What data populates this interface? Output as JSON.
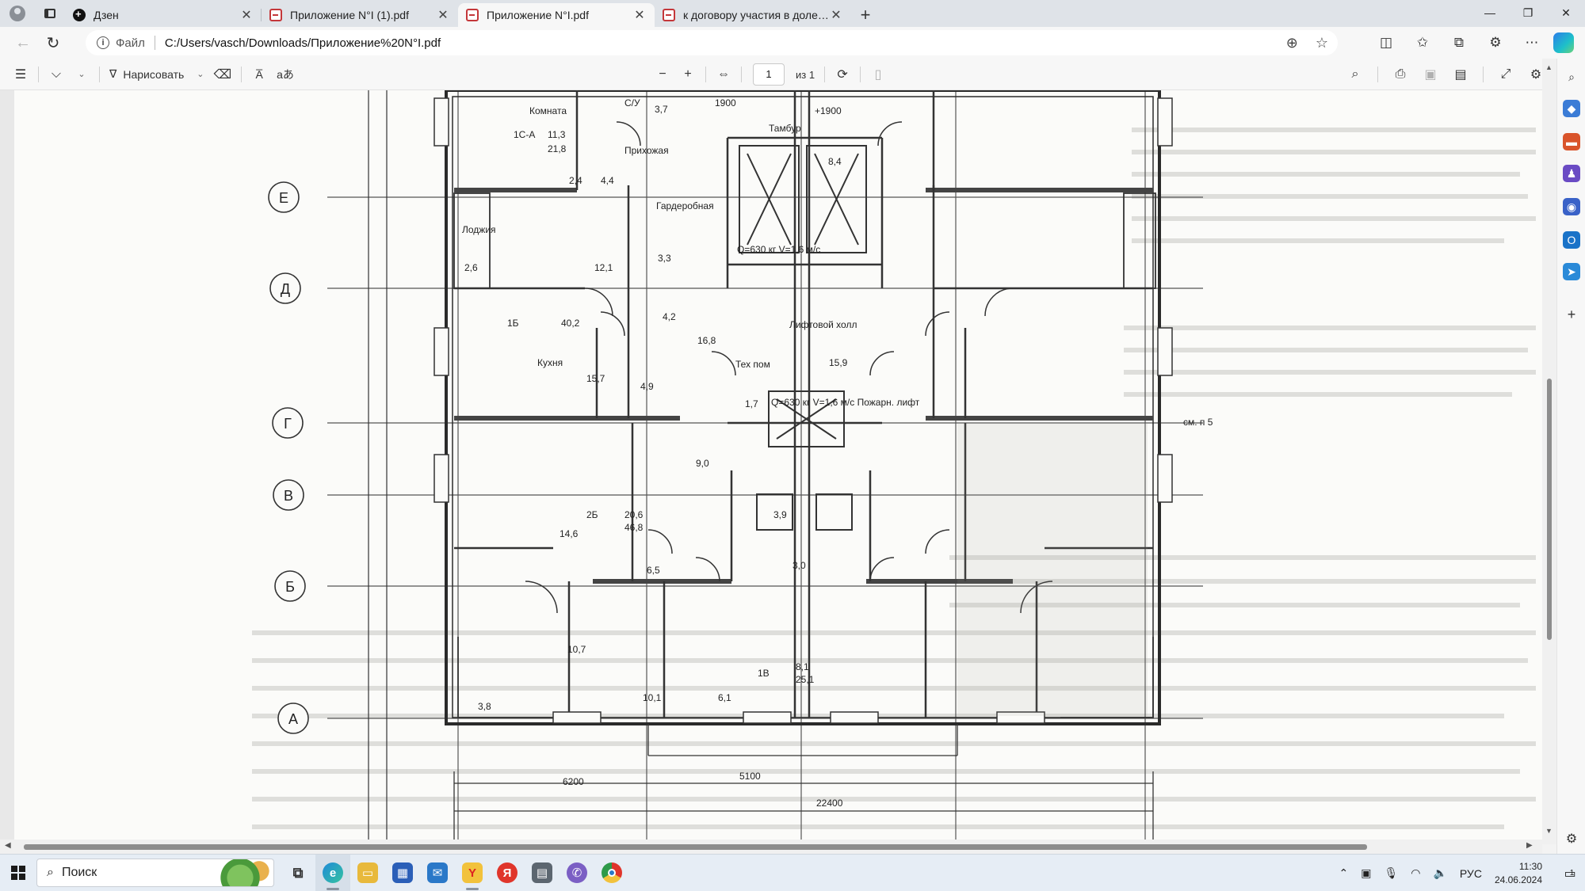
{
  "browser": {
    "tabs": [
      {
        "title": "Дзен",
        "icon": "dzen-icon",
        "active": false
      },
      {
        "title": "Приложение N°I (1).pdf",
        "icon": "pdf-icon",
        "active": false
      },
      {
        "title": "Приложение N°I.pdf",
        "icon": "pdf-icon",
        "active": true
      },
      {
        "title": "к договору участия в долевом",
        "icon": "pdf-icon",
        "active": false
      }
    ],
    "address": {
      "scheme_label": "Файл",
      "url": "C:/Users/vasch/Downloads/Приложение%20N°I.pdf"
    }
  },
  "pdf_toolbar": {
    "draw_label": "Нарисовать",
    "text_tool_label": "A̅",
    "translate_label": "aあ",
    "page_current": "1",
    "page_total_label": "из 1"
  },
  "document": {
    "axis_letters": [
      "Е",
      "Д",
      "Г",
      "В",
      "Б",
      "А"
    ],
    "rooms": [
      {
        "text": "Комната"
      },
      {
        "text": "1С-А"
      },
      {
        "text": "11,3"
      },
      {
        "text": "21,8"
      },
      {
        "text": "Прихожая"
      },
      {
        "text": "С/У"
      },
      {
        "text": "3,7"
      },
      {
        "text": "1900"
      },
      {
        "text": "+1900"
      },
      {
        "text": "Тамбур"
      },
      {
        "text": "Гардеробная"
      },
      {
        "text": "Лоджия"
      },
      {
        "text": "2,6"
      },
      {
        "text": "12,1"
      },
      {
        "text": "1Б"
      },
      {
        "text": "40,2"
      },
      {
        "text": "Кухня"
      },
      {
        "text": "15,7"
      },
      {
        "text": "4,9"
      },
      {
        "text": "16,8"
      },
      {
        "text": "Лифтовой холл"
      },
      {
        "text": "Тех пом"
      },
      {
        "text": "15,9"
      },
      {
        "text": "1,7"
      },
      {
        "text": "Q=630 кг V=1,6 м/с"
      },
      {
        "text": "Q=630 кг V=1,6 м/с Пожарн. лифт"
      },
      {
        "text": "9,0"
      },
      {
        "text": "3,9"
      },
      {
        "text": "2Б"
      },
      {
        "text": "20,6"
      },
      {
        "text": "46,8"
      },
      {
        "text": "14,6"
      },
      {
        "text": "6,5"
      },
      {
        "text": "3,0"
      },
      {
        "text": "1В"
      },
      {
        "text": "8,1"
      },
      {
        "text": "25,1"
      },
      {
        "text": "10,7"
      },
      {
        "text": "10,1"
      },
      {
        "text": "3,8"
      },
      {
        "text": "6,1"
      },
      {
        "text": "см. п 5"
      },
      {
        "text": "6200"
      },
      {
        "text": "5100"
      },
      {
        "text": "22400"
      },
      {
        "text": "8,4"
      },
      {
        "text": "2,4"
      },
      {
        "text": "4,4"
      },
      {
        "text": "3,3"
      },
      {
        "text": "4,2"
      }
    ]
  },
  "taskbar": {
    "search_label": "Поиск",
    "lang": "РУС",
    "time": "11:30",
    "date": "24.06.2024",
    "notif_count": "1"
  }
}
